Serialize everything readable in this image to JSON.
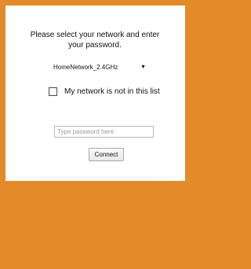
{
  "instruction": "Please select your network and enter your password.",
  "network_select": {
    "selected_value": "HomeNetwork_2.4GHz"
  },
  "not_in_list": {
    "label": "My network is not in this list",
    "checked": false
  },
  "password": {
    "placeholder": "Type password here",
    "value": ""
  },
  "connect_button": {
    "label": "Connect"
  },
  "colors": {
    "background": "#e38b29",
    "panel": "#ffffff"
  }
}
